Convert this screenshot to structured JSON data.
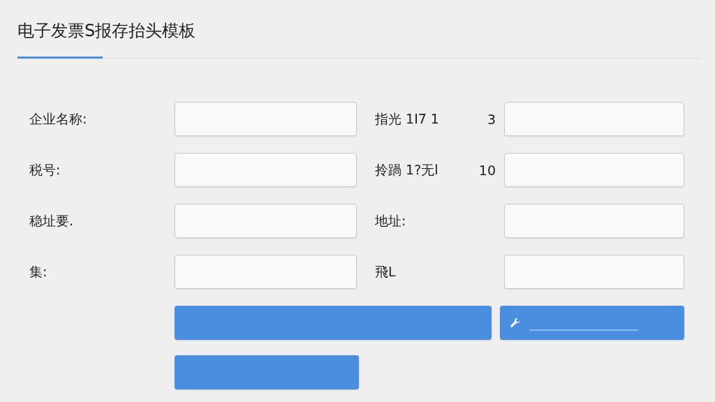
{
  "title": "电子发票S报存抬头模板",
  "rows": [
    {
      "left": {
        "label": "企业名称:"
      },
      "right": {
        "label": "指光 1I7 1",
        "number": "3"
      }
    },
    {
      "left": {
        "label": "税号:"
      },
      "right": {
        "label": "拎踻 1?无l",
        "number": "10"
      }
    },
    {
      "left": {
        "label": "稳址要."
      },
      "right": {
        "label": "地址:"
      }
    },
    {
      "left": {
        "label": "集:"
      },
      "right": {
        "label": "飛L"
      }
    }
  ],
  "buttons": [
    {
      "kind": "wide"
    },
    {
      "kind": "wrench"
    },
    {
      "kind": "plain"
    }
  ]
}
